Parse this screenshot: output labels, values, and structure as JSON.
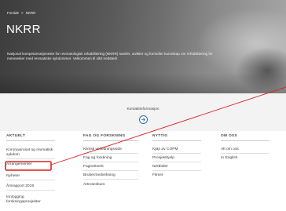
{
  "breadcrumb": {
    "home": "Forside",
    "separator": ">",
    "current": "NKRR"
  },
  "hero": {
    "title": "NKRR",
    "intro": "Nasjonal kompetansetjeneste for revmatologisk rehabilitering (NKRR) samler, utvikler og formidler kunnskap om rehabilitering for mennesker med revmatiske sykdommer. Velkommen til vårt nettsted!"
  },
  "contact": {
    "label": "Kontaktinformasjon",
    "button_icon": "arrow-right-icon"
  },
  "columns": [
    {
      "heading": "AKTUELT",
      "links": [
        "Koronaviruset og revmatisk sykdom",
        "Arrangementer",
        "Nyheter",
        "Årsrapport 2019",
        "Innlogging forskningsprosjekter"
      ]
    },
    {
      "heading": "FAG OG FORSKNING",
      "links": [
        "Klinisk veiledningsside",
        "Fag og forskning",
        "Fagnettverk",
        "Brukermedvirkning",
        "Artroseskurs"
      ]
    },
    {
      "heading": "NYTTIG",
      "links": [
        "Kjøp av COPM",
        "Prosjekthjelp",
        "Nettbider",
        "Filmer"
      ]
    },
    {
      "heading": "OM OSS",
      "links": [
        "Alt om oss",
        "In English"
      ]
    }
  ],
  "annotation": {
    "highlight_color": "#e02020",
    "highlighted_item": "Arrangementer"
  }
}
